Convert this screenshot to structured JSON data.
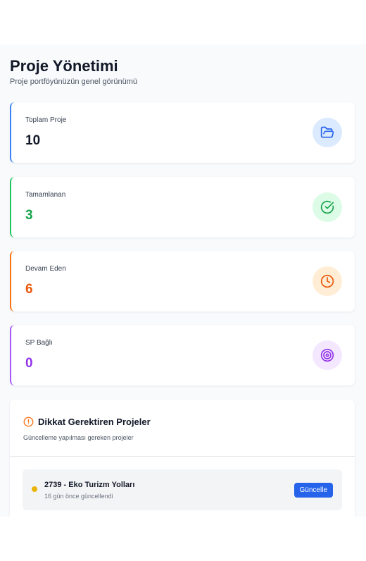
{
  "header": {
    "title": "Proje Yönetimi",
    "subtitle": "Proje portföyünüzün genel görünümü"
  },
  "stats": [
    {
      "label": "Toplam Proje",
      "value": "10",
      "icon": "folder-open-icon",
      "color": "#3b82f6",
      "icon_bg": "#dbeafe",
      "value_color": "#111827"
    },
    {
      "label": "Tamamlanan",
      "value": "3",
      "icon": "check-circle-icon",
      "color": "#22c55e",
      "icon_bg": "#dcfce7",
      "value_color": "#16a34a"
    },
    {
      "label": "Devam Eden",
      "value": "6",
      "icon": "clock-icon",
      "color": "#f97316",
      "icon_bg": "#ffedd5",
      "value_color": "#ea580c"
    },
    {
      "label": "SP Bağlı",
      "value": "0",
      "icon": "target-icon",
      "color": "#a855f7",
      "icon_bg": "#f3e8ff",
      "value_color": "#9333ea"
    }
  ],
  "attention": {
    "title": "Dikkat Gerektiren Projeler",
    "subtitle": "Güncelleme yapılması gereken projeler",
    "icon": "alert-circle-icon",
    "items": [
      {
        "name": "2739 - Eko Turizm Yolları",
        "updated": "16 gün önce güncellendi",
        "button_label": "Güncelle",
        "status_color": "#eab308"
      }
    ]
  }
}
